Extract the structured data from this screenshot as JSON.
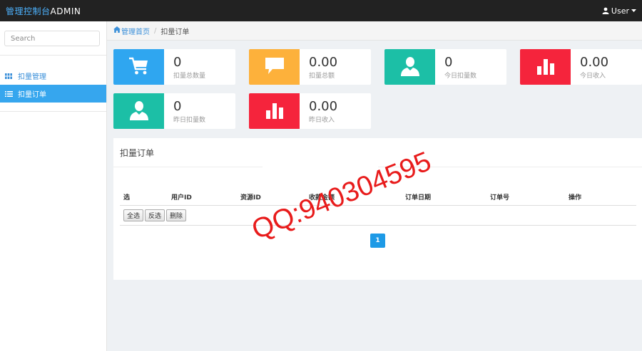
{
  "header": {
    "brand_cn": "管理控制台",
    "brand_en": "ADMIN",
    "user_label": "User"
  },
  "sidebar": {
    "search_placeholder": "Search",
    "items": [
      {
        "label": "扣量管理",
        "icon": "grid-icon",
        "active": false
      },
      {
        "label": "扣量订单",
        "icon": "list-icon",
        "active": true
      }
    ]
  },
  "breadcrumb": {
    "home": "管理首页",
    "current": "扣量订单"
  },
  "stats": [
    {
      "value": "0",
      "label": "扣量总数量",
      "icon": "cart-icon",
      "color": "#2fa6f0"
    },
    {
      "value": "0.00",
      "label": "扣量总额",
      "icon": "comment-icon",
      "color": "#fdb13b"
    },
    {
      "value": "0",
      "label": "今日扣量数",
      "icon": "user-icon",
      "color": "#1cbfa6"
    },
    {
      "value": "0.00",
      "label": "今日收入",
      "icon": "bar-chart-icon",
      "color": "#f5243c"
    },
    {
      "value": "0",
      "label": "昨日扣量数",
      "icon": "user-icon",
      "color": "#1cbfa6"
    },
    {
      "value": "0.00",
      "label": "昨日收入",
      "icon": "bar-chart-icon",
      "color": "#f5243c"
    }
  ],
  "panel": {
    "title": "扣量订单",
    "columns": [
      "选",
      "用户ID",
      "资源ID",
      "收款金额",
      "订单日期",
      "订单号",
      "操作"
    ],
    "buttons": {
      "select_all": "全选",
      "invert": "反选",
      "delete": "删除"
    },
    "page": "1"
  },
  "watermark": "QQ:940304595"
}
